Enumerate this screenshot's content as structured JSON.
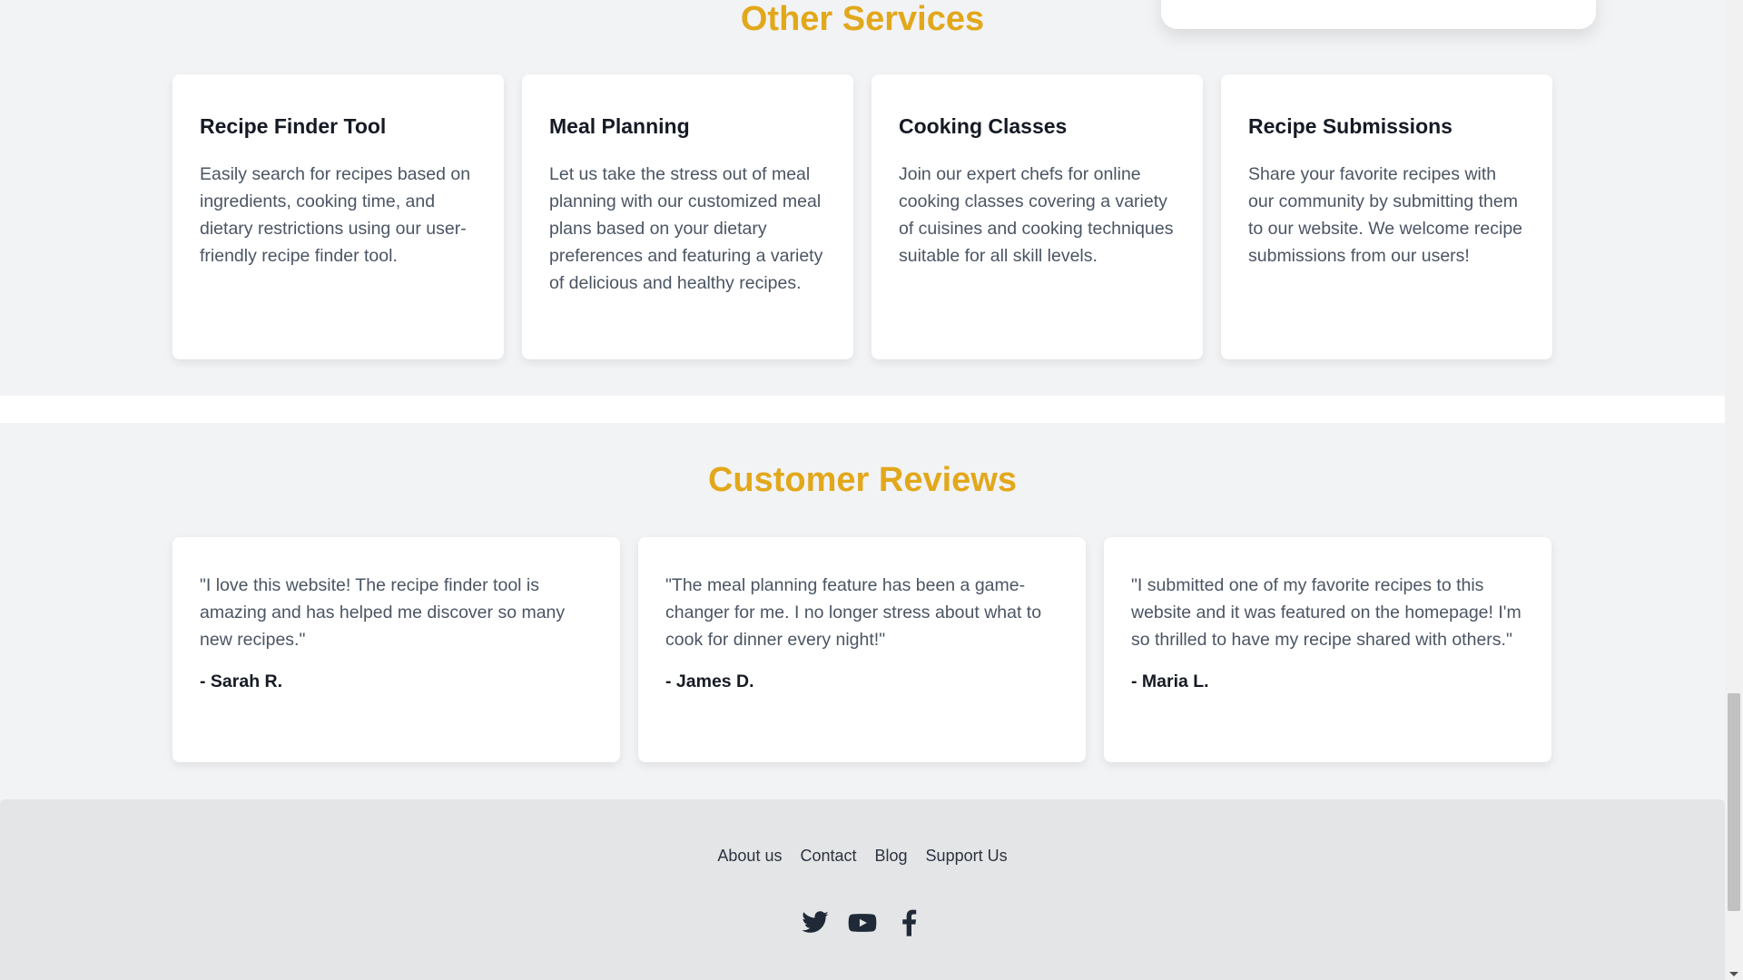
{
  "services": {
    "title": "Other Services",
    "cards": [
      {
        "title": "Recipe Finder Tool",
        "text": "Easily search for recipes based on ingredients, cooking time, and dietary restrictions using our user-friendly recipe finder tool."
      },
      {
        "title": "Meal Planning",
        "text": "Let us take the stress out of meal planning with our customized meal plans based on your dietary preferences and featuring a variety of delicious and healthy recipes."
      },
      {
        "title": "Cooking Classes",
        "text": "Join our expert chefs for online cooking classes covering a variety of cuisines and cooking techniques suitable for all skill levels."
      },
      {
        "title": "Recipe Submissions",
        "text": "Share your favorite recipes with our community by submitting them to our website. We welcome recipe submissions from our users!"
      }
    ]
  },
  "reviews": {
    "title": "Customer Reviews",
    "items": [
      {
        "quote": "\"I love this website! The recipe finder tool is amazing and has helped me discover so many new recipes.\"",
        "author": "- Sarah R."
      },
      {
        "quote": "\"The meal planning feature has been a game-changer for me. I no longer stress about what to cook for dinner every night!\"",
        "author": "- James D."
      },
      {
        "quote": "\"I submitted one of my favorite recipes to this website and it was featured on the homepage! I'm so thrilled to have my recipe shared with others.\"",
        "author": "- Maria L."
      }
    ]
  },
  "footer": {
    "links": [
      "About us",
      "Contact",
      "Blog",
      "Support Us"
    ],
    "social_icons": [
      "twitter-icon",
      "youtube-icon",
      "facebook-icon"
    ]
  },
  "colors": {
    "accent": "#e2a81b",
    "background": "#f2f3f5",
    "footer_bg": "#e4e5e6",
    "heading": "#151a24",
    "body_text": "#4b5563"
  }
}
